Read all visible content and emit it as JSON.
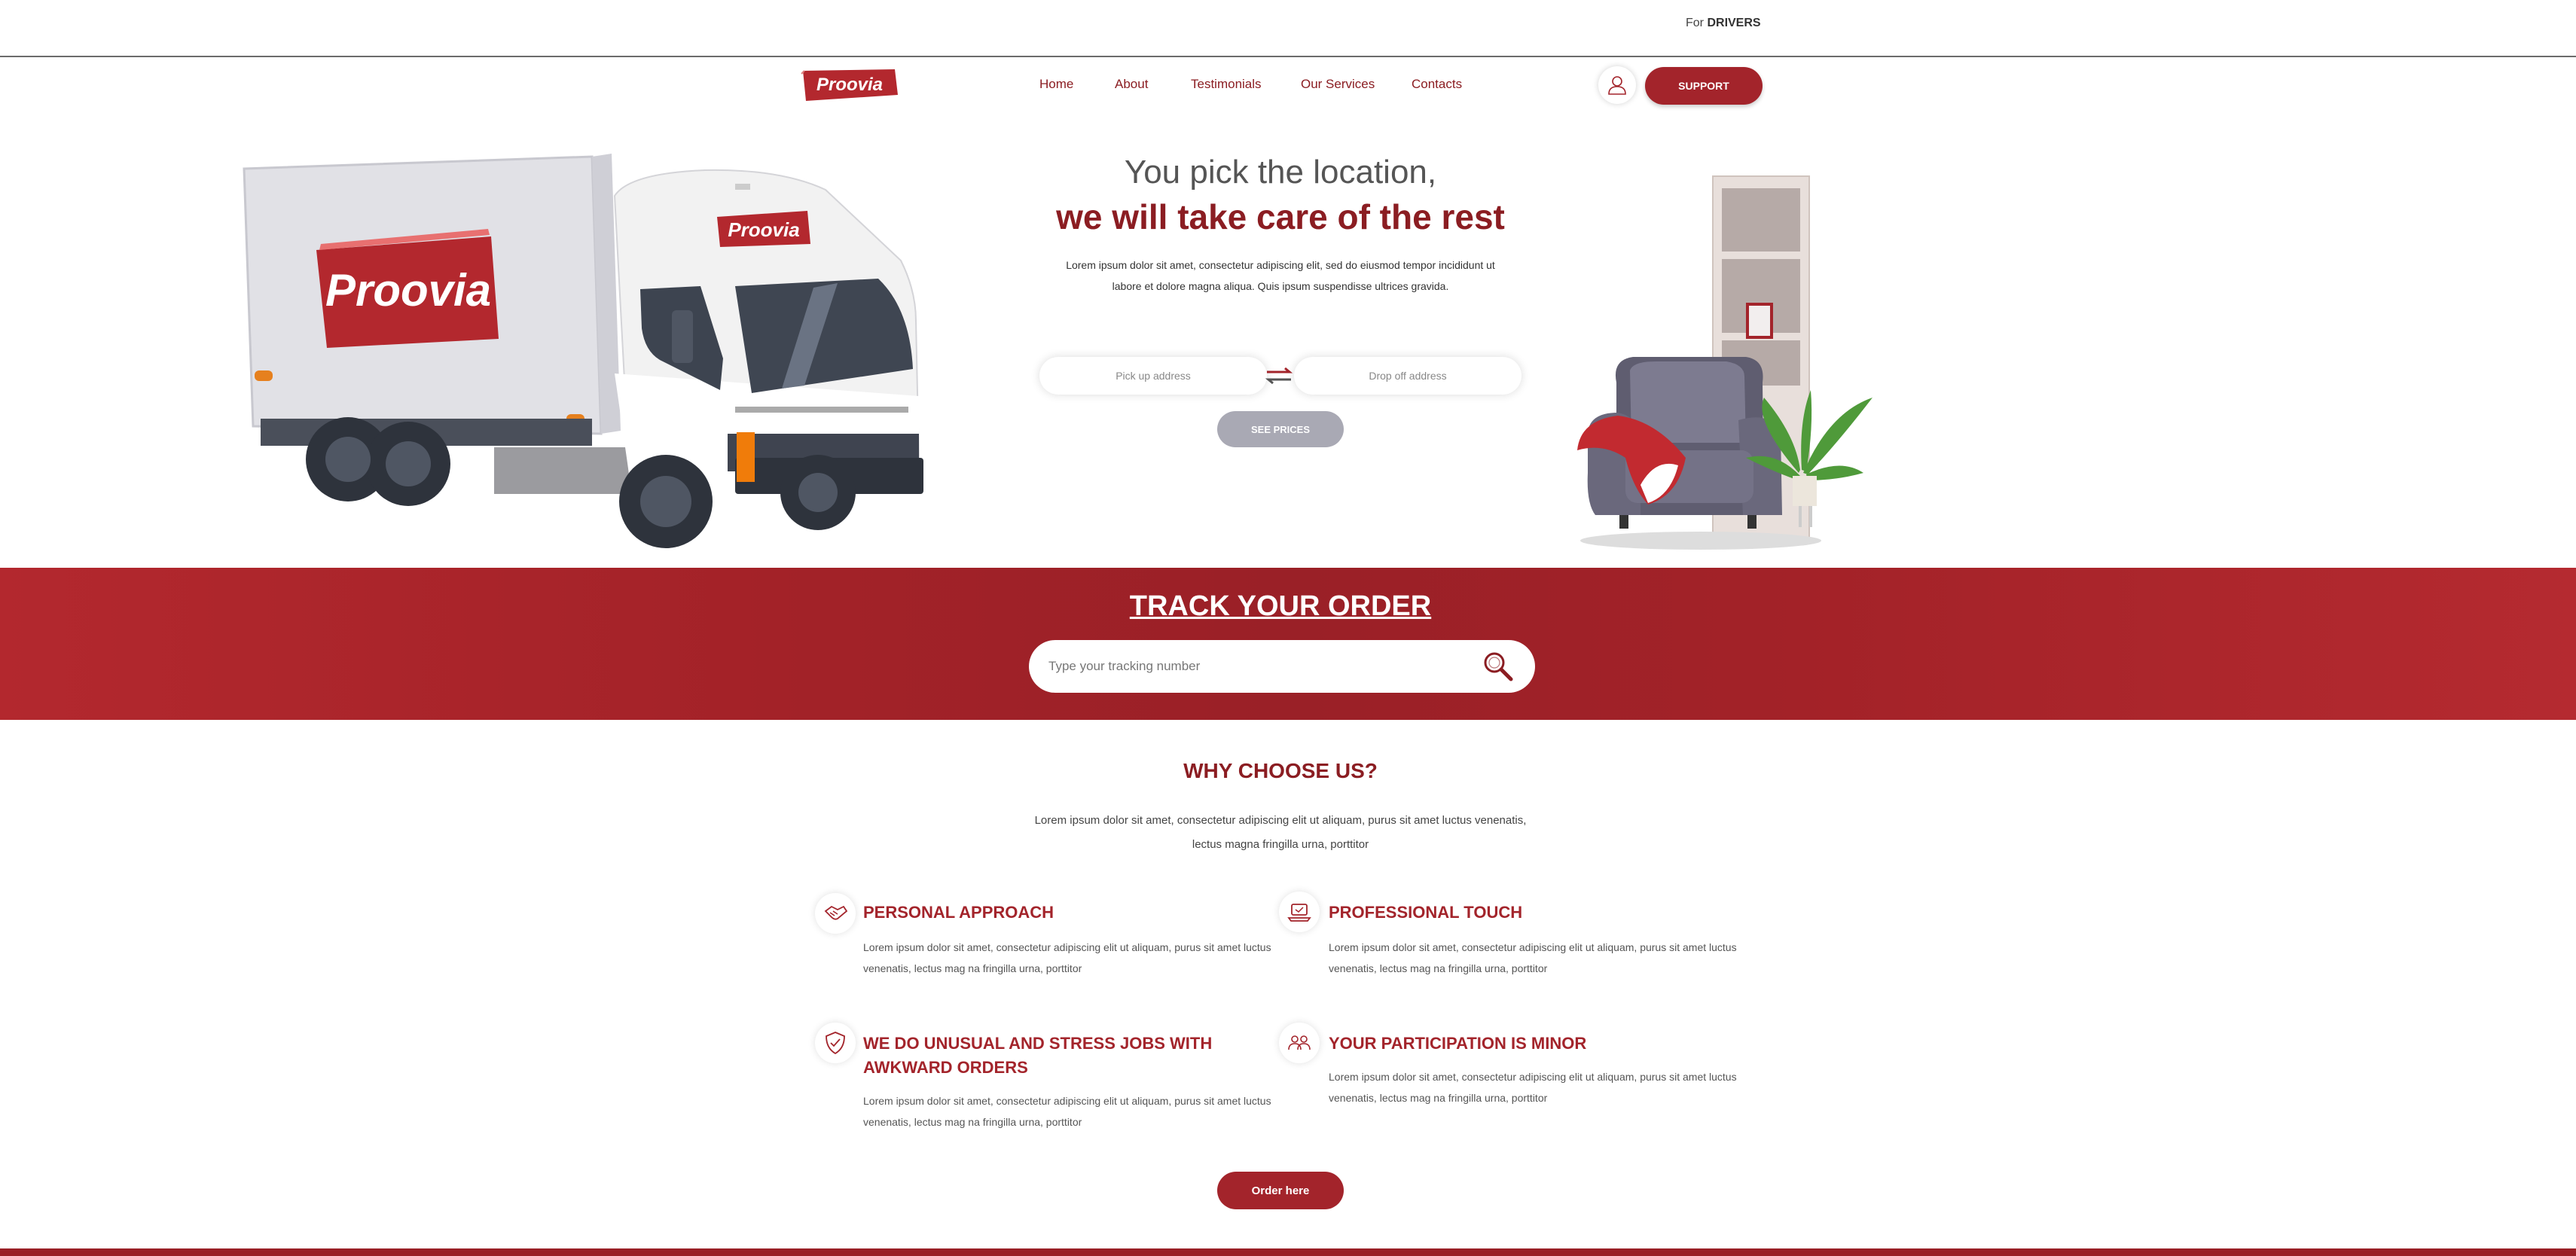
{
  "topbar": {
    "for_prefix": "For",
    "drivers_label": "DRIVERS"
  },
  "brand": {
    "logo_text": "Proovia"
  },
  "nav": {
    "items": [
      "Home",
      "About",
      "Testimonials",
      "Our Services",
      "Contacts"
    ]
  },
  "header": {
    "user_icon": "user-icon",
    "support_label": "SUPPORT"
  },
  "hero": {
    "title_line1": "You pick the location,",
    "title_line2": "we will take care of the rest",
    "description": "Lorem ipsum dolor sit amet, consectetur adipiscing elit, sed do eiusmod tempor incididunt ut labore et dolore magna aliqua. Quis ipsum suspendisse ultrices gravida.",
    "pickup_placeholder": "Pick up address",
    "dropoff_placeholder": "Drop off address",
    "see_prices_label": "SEE PRICES"
  },
  "track": {
    "title": "TRACK YOUR ORDER",
    "placeholder": "Type your tracking number"
  },
  "why": {
    "title": "WHY CHOOSE US?",
    "description": "Lorem ipsum dolor sit amet, consectetur adipiscing elit ut aliquam, purus sit amet luctus venenatis, lectus magna fringilla urna, porttitor",
    "features": [
      {
        "title": "PERSONAL APPROACH",
        "text": "Lorem ipsum dolor sit amet, consectetur adipiscing elit ut aliquam, purus sit amet luctus venenatis, lectus mag na fringilla urna, porttitor",
        "icon": "handshake-icon"
      },
      {
        "title": "PROFESSIONAL TOUCH",
        "text": "Lorem ipsum dolor sit amet, consectetur adipiscing elit ut aliquam, purus sit amet luctus venenatis, lectus mag na fringilla urna, porttitor",
        "icon": "laptop-icon"
      },
      {
        "title": "WE DO UNUSUAL AND STRESS JOBS WITH AWKWARD ORDERS",
        "text": "Lorem ipsum dolor sit amet, consectetur adipiscing elit ut aliquam, purus sit amet luctus venenatis, lectus mag na fringilla urna, porttitor",
        "icon": "shield-check-icon"
      },
      {
        "title": "YOUR PARTICIPATION IS MINOR",
        "text": "Lorem ipsum dolor sit amet, consectetur adipiscing elit ut aliquam, purus sit amet luctus venenatis, lectus mag na fringilla urna, porttitor",
        "icon": "group-icon"
      }
    ],
    "order_label": "Order here"
  },
  "colors": {
    "brand_red": "#a3242b",
    "dark_red": "#8b1d22",
    "disabled_button": "#a9a9b4"
  }
}
